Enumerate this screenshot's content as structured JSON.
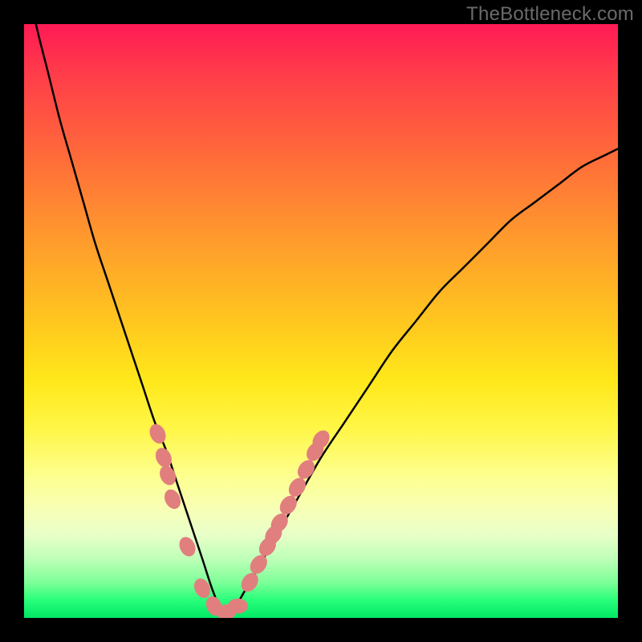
{
  "watermark": "TheBottleneck.com",
  "chart_data": {
    "type": "line",
    "title": "",
    "xlabel": "",
    "ylabel": "",
    "xlim": [
      0,
      100
    ],
    "ylim": [
      0,
      100
    ],
    "grid": false,
    "series": [
      {
        "name": "bottleneck-curve",
        "x": [
          0,
          2,
          4,
          6,
          8,
          10,
          12,
          14,
          16,
          18,
          20,
          22,
          24,
          26,
          28,
          30,
          32,
          34,
          38,
          42,
          46,
          50,
          54,
          58,
          62,
          66,
          70,
          74,
          78,
          82,
          86,
          90,
          94,
          98,
          100
        ],
        "values": [
          110,
          100,
          92,
          84,
          77,
          70,
          63,
          57,
          51,
          45,
          39,
          33,
          28,
          22,
          16,
          10,
          4,
          0,
          6,
          13,
          20,
          27,
          33,
          39,
          45,
          50,
          55,
          59,
          63,
          67,
          70,
          73,
          76,
          78,
          79
        ]
      }
    ],
    "markers": [
      {
        "x": 22.5,
        "y": 31
      },
      {
        "x": 23.5,
        "y": 27
      },
      {
        "x": 24.2,
        "y": 24
      },
      {
        "x": 25.0,
        "y": 20
      },
      {
        "x": 27.5,
        "y": 12
      },
      {
        "x": 30.0,
        "y": 5
      },
      {
        "x": 32.0,
        "y": 2
      },
      {
        "x": 34.0,
        "y": 1
      },
      {
        "x": 36.0,
        "y": 2
      },
      {
        "x": 38.0,
        "y": 6
      },
      {
        "x": 39.5,
        "y": 9
      },
      {
        "x": 41.0,
        "y": 12
      },
      {
        "x": 42.0,
        "y": 14
      },
      {
        "x": 43.0,
        "y": 16
      },
      {
        "x": 44.5,
        "y": 19
      },
      {
        "x": 46.0,
        "y": 22
      },
      {
        "x": 47.5,
        "y": 25
      },
      {
        "x": 49.0,
        "y": 28
      },
      {
        "x": 50.0,
        "y": 30
      }
    ],
    "marker_color": "#e17f7f",
    "line_color": "#000000",
    "marker_radius_px": 11
  },
  "colors": {
    "frame": "#000000",
    "watermark": "#6a6a6a"
  }
}
